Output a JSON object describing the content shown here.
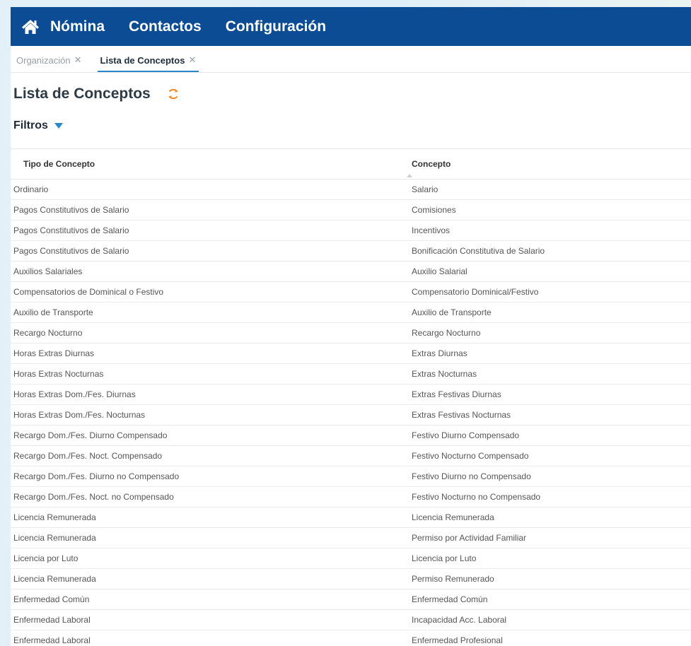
{
  "nav": {
    "items": [
      "Nómina",
      "Contactos",
      "Configuración"
    ],
    "color": "#0b4c95"
  },
  "tabs": [
    {
      "label": "Organización",
      "active": false
    },
    {
      "label": "Lista de Conceptos",
      "active": true
    }
  ],
  "page": {
    "title": "Lista de Conceptos",
    "filters_label": "Filtros"
  },
  "colors": {
    "refresh": "#f08a24",
    "accent": "#2a87c8"
  },
  "table": {
    "columns": [
      "Tipo de Concepto",
      "Concepto"
    ],
    "rows": [
      [
        "Ordinario",
        "Salario"
      ],
      [
        "Pagos Constitutivos de Salario",
        "Comisiones"
      ],
      [
        "Pagos Constitutivos de Salario",
        "Incentivos"
      ],
      [
        "Pagos Constitutivos de Salario",
        "Bonificación Constitutiva de Salario"
      ],
      [
        "Auxilios Salariales",
        "Auxilio Salarial"
      ],
      [
        "Compensatorios de Dominical o Festivo",
        "Compensatorio Dominical/Festivo"
      ],
      [
        "Auxilio de Transporte",
        "Auxilio de Transporte"
      ],
      [
        "Recargo Nocturno",
        "Recargo Nocturno"
      ],
      [
        "Horas Extras Diurnas",
        "Extras Diurnas"
      ],
      [
        "Horas Extras Nocturnas",
        "Extras Nocturnas"
      ],
      [
        "Horas Extras Dom./Fes. Diurnas",
        "Extras Festivas Diurnas"
      ],
      [
        "Horas Extras Dom./Fes. Nocturnas",
        "Extras Festivas Nocturnas"
      ],
      [
        "Recargo Dom./Fes. Diurno Compensado",
        "Festivo Diurno Compensado"
      ],
      [
        "Recargo Dom./Fes. Noct. Compensado",
        "Festivo Nocturno Compensado"
      ],
      [
        "Recargo Dom./Fes. Diurno no Compensado",
        "Festivo Diurno no Compensado"
      ],
      [
        "Recargo Dom./Fes. Noct. no Compensado",
        "Festivo Nocturno no Compensado"
      ],
      [
        "Licencia Remunerada",
        "Licencia Remunerada"
      ],
      [
        "Licencia Remunerada",
        "Permiso por Actividad Familiar"
      ],
      [
        "Licencia por Luto",
        "Licencia por Luto"
      ],
      [
        "Licencia Remunerada",
        "Permiso Remunerado"
      ],
      [
        "Enfermedad Común",
        "Enfermedad Común"
      ],
      [
        "Enfermedad Laboral",
        "Incapacidad Acc. Laboral"
      ],
      [
        "Enfermedad Laboral",
        "Enfermedad Profesional"
      ]
    ]
  }
}
